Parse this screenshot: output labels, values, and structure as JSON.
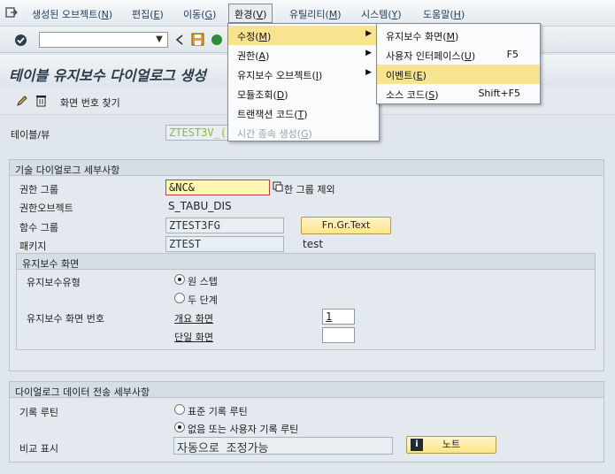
{
  "menubar": {
    "items": [
      {
        "label": "생성된 오브젝트(",
        "key": "N",
        "end": ")"
      },
      {
        "label": "편집(",
        "key": "E",
        "end": ")"
      },
      {
        "label": "이동(",
        "key": "G",
        "end": ")"
      },
      {
        "label": "환경(",
        "key": "V",
        "end": ")"
      },
      {
        "label": "유틸리티(",
        "key": "M",
        "end": ")"
      },
      {
        "label": "시스템(",
        "key": "Y",
        "end": ")"
      },
      {
        "label": "도움말(",
        "key": "H",
        "end": ")"
      }
    ]
  },
  "page": {
    "title": "테이블 유지보수 다이얼로그 생성",
    "find_screen_label": "화면 번호 찾기"
  },
  "fields": {
    "table_view": {
      "label": "테이블/뷰",
      "value": "ZTEST3V_("
    },
    "tech_section": "기술 다이얼로그 세부사항",
    "auth_group": {
      "label": "권한 그룹",
      "value": "&NC&",
      "suffix": "한 그룹 제외"
    },
    "auth_object": {
      "label": "권한오브젝트",
      "value": "S_TABU_DIS"
    },
    "function_group": {
      "label": "함수 그룹",
      "value": "ZTEST3FG",
      "button": "Fn.Gr.Text"
    },
    "package": {
      "label": "패키지",
      "value": "ZTEST",
      "desc": "test"
    },
    "maint_screen": {
      "title": "유지보수 화면",
      "type_label": "유지보수유형",
      "opt_one": "원 스텝",
      "opt_two": "두 단계",
      "number_label": "유지보수 화면 번호",
      "overview_label": "개요 화면",
      "overview_value": "1",
      "single_label": "단일 화면",
      "single_value": ""
    },
    "transfer": {
      "title": "다이얼로그 데이터 전송 세부사항",
      "recording_label": "기록 루틴",
      "opt_std": "표준 기록 루틴",
      "opt_user": "없음 또는 사용자 기록 루틴",
      "compare_label": "비교 표시",
      "compare_value": "자동으로 조정가능",
      "note_button": "노트"
    }
  },
  "menu_env": {
    "items": [
      {
        "label": "수정(",
        "key": "M",
        "end": ")",
        "arrow": "▶"
      },
      {
        "label": "권한(",
        "key": "A",
        "end": ")",
        "arrow": "▶"
      },
      {
        "label": "유지보수 오브젝트(",
        "key": "I",
        "end": ")",
        "arrow": "▶"
      },
      {
        "label": "모듈조회(",
        "key": "D",
        "end": ")"
      },
      {
        "label": "트랜잭션 코드(",
        "key": "T",
        "end": ")"
      },
      {
        "label": "시간 종속 생성(",
        "key": "G",
        "end": ")"
      }
    ]
  },
  "menu_modify": {
    "items": [
      {
        "label": "유지보수 화면(",
        "key": "M",
        "end": ")"
      },
      {
        "label": "사용자 인터페이스(",
        "key": "U",
        "end": ")",
        "accel": "F5"
      },
      {
        "label": "이벤트(",
        "key": "E",
        "end": ")"
      },
      {
        "label": "소스 코드(",
        "key": "S",
        "end": ")",
        "accel": "Shift+F5"
      }
    ]
  }
}
